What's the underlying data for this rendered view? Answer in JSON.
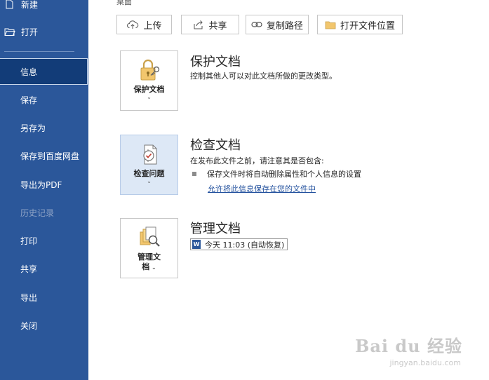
{
  "sidebar": {
    "new_label": "新建",
    "open_label": "打开",
    "items": [
      {
        "label": "信息"
      },
      {
        "label": "保存"
      },
      {
        "label": "另存为"
      },
      {
        "label": "保存到百度网盘"
      },
      {
        "label": "导出为PDF"
      },
      {
        "label": "历史记录"
      },
      {
        "label": "打印"
      },
      {
        "label": "共享"
      },
      {
        "label": "导出"
      },
      {
        "label": "关闭"
      }
    ]
  },
  "breadcrumb": "桌面",
  "toolbar": {
    "upload": "上传",
    "share": "共享",
    "copy_path": "复制路径",
    "open_location": "打开文件位置"
  },
  "protect": {
    "tile_label": "保护文档",
    "title": "保护文档",
    "desc": "控制其他人可以对此文档所做的更改类型。"
  },
  "inspect": {
    "tile_label": "检查问题",
    "title": "检查文档",
    "desc": "在发布此文件之前，请注意其是否包含:",
    "bullet": "保存文件时将自动删除属性和个人信息的设置",
    "link": "允许将此信息保存在您的文件中"
  },
  "manage": {
    "tile_label_line1": "管理文",
    "tile_label_line2": "档",
    "title": "管理文档",
    "version": "今天 11:03 (自动恢复)"
  },
  "watermark": {
    "brand": "Bai du 经验",
    "url": "jingyan.baidu.com"
  },
  "colors": {
    "sidebar_bg": "#2b579a",
    "selected_bg": "#123c78",
    "link": "#1f4e9c"
  }
}
